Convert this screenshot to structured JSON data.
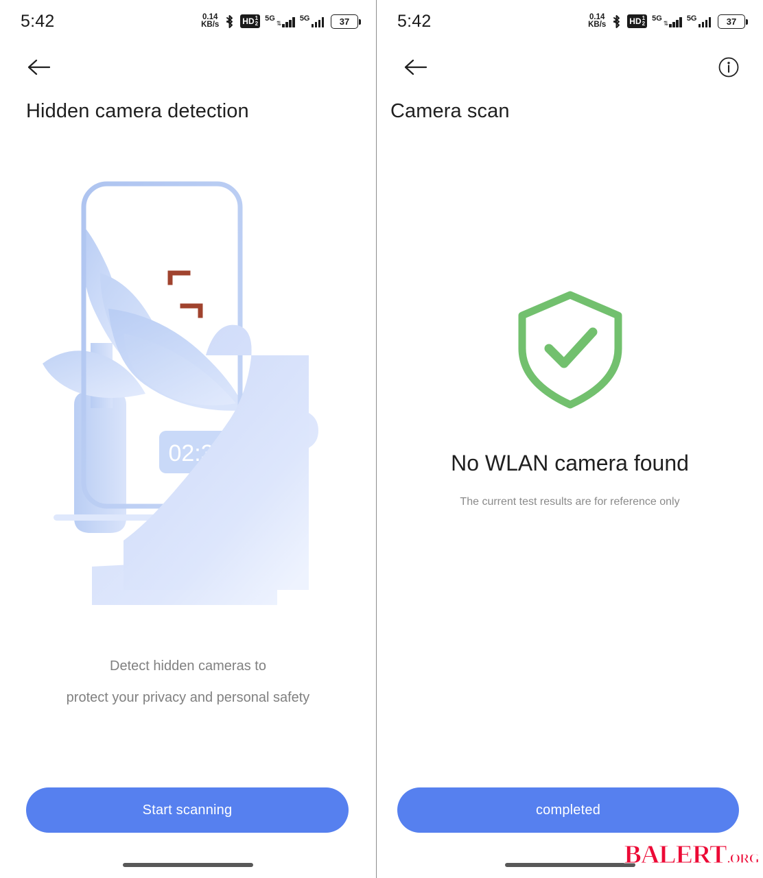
{
  "colors": {
    "accent_blue": "#5680ef",
    "illustration_blue": "#aec4f0",
    "illustration_blue_light": "#d6e1fa",
    "scan_bracket_red": "#a0432e",
    "shield_green": "#72c06e",
    "text_primary": "#1f1f1f",
    "text_secondary": "#808080",
    "watermark_red": "#ec0a36"
  },
  "status_bar": {
    "time": "5:42",
    "network_speed_value": "0.14",
    "network_speed_unit": "KB/s",
    "bluetooth_icon": "bluetooth-icon",
    "hd_label": "HD",
    "hd_sup": "1",
    "hd_sub": "2",
    "sim1_network": "5G",
    "sim2_network": "5G",
    "battery_percent": "37"
  },
  "screens": [
    {
      "id": "hidden-camera-detection",
      "appbar": {
        "back_icon": "back-arrow-icon",
        "info_icon": null
      },
      "title": "Hidden camera detection",
      "illustration": {
        "name": "hand-holding-phone-scanning-plant",
        "scan_bracket_icon": "scan-bracket-icon",
        "timer_label": "02:36"
      },
      "caption_line1": "Detect hidden cameras to",
      "caption_line2": "protect your privacy and personal safety",
      "cta_label": "Start scanning"
    },
    {
      "id": "camera-scan-result",
      "appbar": {
        "back_icon": "back-arrow-icon",
        "info_icon": "info-circle-icon"
      },
      "title": "Camera scan",
      "result_icon": "shield-check-icon",
      "result_title": "No WLAN camera found",
      "result_subtitle": "The current test results are for reference only",
      "cta_label": "completed"
    }
  ],
  "watermark": {
    "main": "BALERT",
    "tld": ".ORG"
  }
}
